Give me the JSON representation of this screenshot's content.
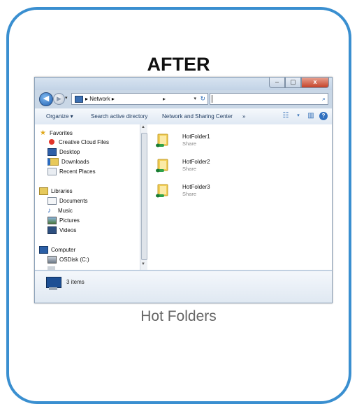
{
  "heading": "AFTER",
  "caption": "Hot Folders",
  "window": {
    "caption_buttons": [
      "–",
      "▢",
      "x"
    ],
    "address": {
      "segments": [
        "Network",
        "▸"
      ],
      "separator": "▸"
    },
    "toolbar": {
      "organize": "Organize ▾",
      "search_ad": "Search active directory",
      "network_center": "Network and Sharing Center",
      "overflow": "»"
    },
    "nav": {
      "favorites": "Favorites",
      "creative_cloud": "Creative Cloud Files",
      "desktop": "Desktop",
      "downloads": "Downloads",
      "recent_places": "Recent Places",
      "libraries": "Libraries",
      "documents": "Documents",
      "music": "Music",
      "pictures": "Pictures",
      "videos": "Videos",
      "computer": "Computer",
      "osdisk": "OSDisk (C:)"
    },
    "folders": [
      {
        "name": "HotFolder1",
        "type": "Share"
      },
      {
        "name": "HotFolder2",
        "type": "Share"
      },
      {
        "name": "HotFolder3",
        "type": "Share"
      }
    ],
    "status": "3 items"
  },
  "colors": {
    "frame_border": "#3a8fd0",
    "folder_yellow": "#f2cf55",
    "share_green": "#2fa24a"
  }
}
